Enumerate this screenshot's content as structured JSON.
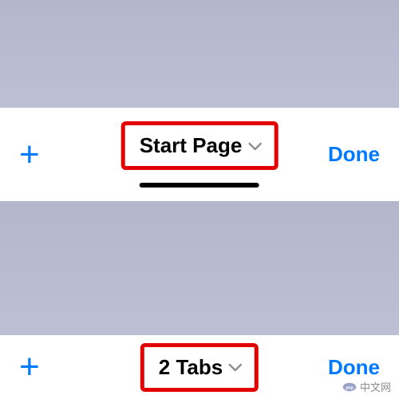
{
  "panels": [
    {
      "plus_label": "+",
      "title": "Start Page",
      "done_label": "Done"
    },
    {
      "plus_label": "+",
      "title": "2 Tabs",
      "done_label": "Done"
    }
  ],
  "watermark": {
    "text": "中文网",
    "brand": "php"
  },
  "colors": {
    "accent": "#007aff",
    "highlight_border": "#e30000"
  }
}
